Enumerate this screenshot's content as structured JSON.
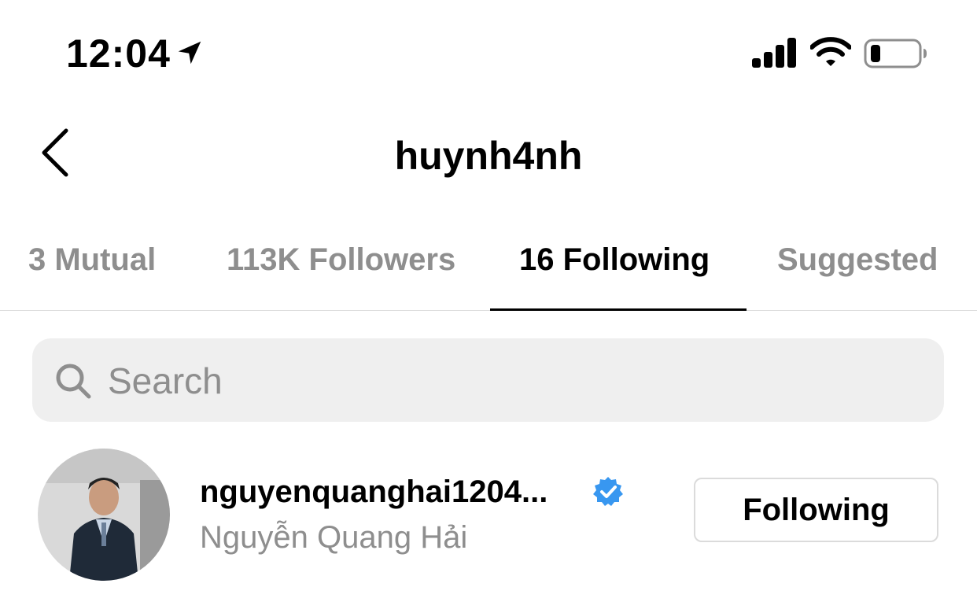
{
  "status_bar": {
    "time": "12:04",
    "location_icon": "location-arrow-icon",
    "signal_icon": "cellular-signal-icon",
    "wifi_icon": "wifi-icon",
    "battery_icon": "battery-icon",
    "battery_level": 0.18
  },
  "header": {
    "back_icon": "chevron-left-icon",
    "title": "huynh4nh"
  },
  "tabs": [
    {
      "label": "3 Mutual",
      "active": false
    },
    {
      "label": "113K Followers",
      "active": false
    },
    {
      "label": "16 Following",
      "active": true
    },
    {
      "label": "Suggested",
      "active": false
    }
  ],
  "search": {
    "icon": "search-icon",
    "placeholder": "Search",
    "value": ""
  },
  "users": [
    {
      "username": "nguyenquanghai1204...",
      "full_name": "Nguyễn Quang Hải",
      "verified": true,
      "verified_icon": "verified-badge-icon",
      "button_label": "Following"
    }
  ],
  "colors": {
    "secondary_text": "#8e8e8e",
    "divider": "#dbdbdb",
    "search_bg": "#efefef",
    "verified_blue": "#3897f0"
  }
}
